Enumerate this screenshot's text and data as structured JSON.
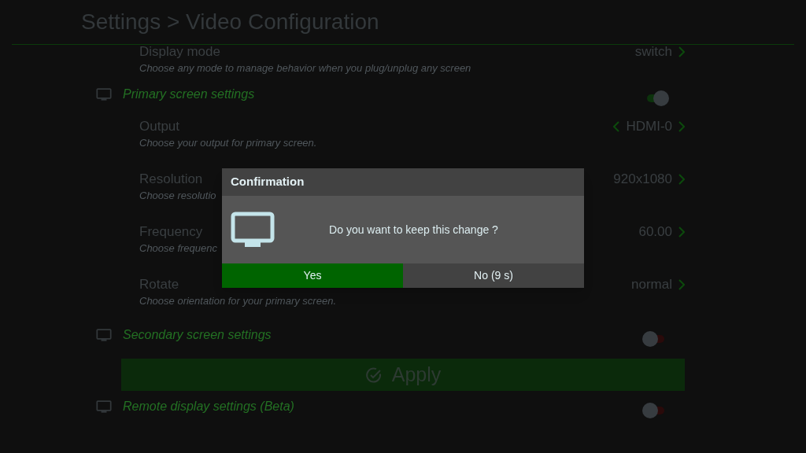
{
  "title": "Settings > Video Configuration",
  "items": [
    {
      "kind": "row",
      "label": "Display mode",
      "description": "Choose any mode to manage behavior when you plug/unplug any screen",
      "value": "switch",
      "prev_arrow": false
    },
    {
      "kind": "section",
      "label": "Primary screen settings",
      "on": true
    },
    {
      "kind": "row",
      "label": "Output",
      "description": "Choose your output for primary screen.",
      "value": "HDMI-0",
      "prev_arrow": true
    },
    {
      "kind": "row",
      "label": "Resolution",
      "description": "Choose resolutio",
      "value": "920x1080",
      "prev_arrow": false
    },
    {
      "kind": "row",
      "label": "Frequency",
      "description": "Choose frequenc",
      "value": "60.00",
      "prev_arrow": false
    },
    {
      "kind": "row",
      "label": "Rotate",
      "description": "Choose orientation for your primary screen.",
      "value": "normal",
      "prev_arrow": false
    },
    {
      "kind": "section",
      "label": "Secondary screen settings",
      "on": false
    },
    {
      "kind": "button",
      "label": "Apply"
    },
    {
      "kind": "section",
      "label": "Remote display settings (Beta)",
      "on": false
    }
  ],
  "dialog": {
    "title": "Confirmation",
    "message": "Do you want to keep this change ?",
    "buttons": [
      {
        "label": "Yes",
        "selected": true
      },
      {
        "label": "No (9 s)",
        "selected": false
      }
    ]
  }
}
